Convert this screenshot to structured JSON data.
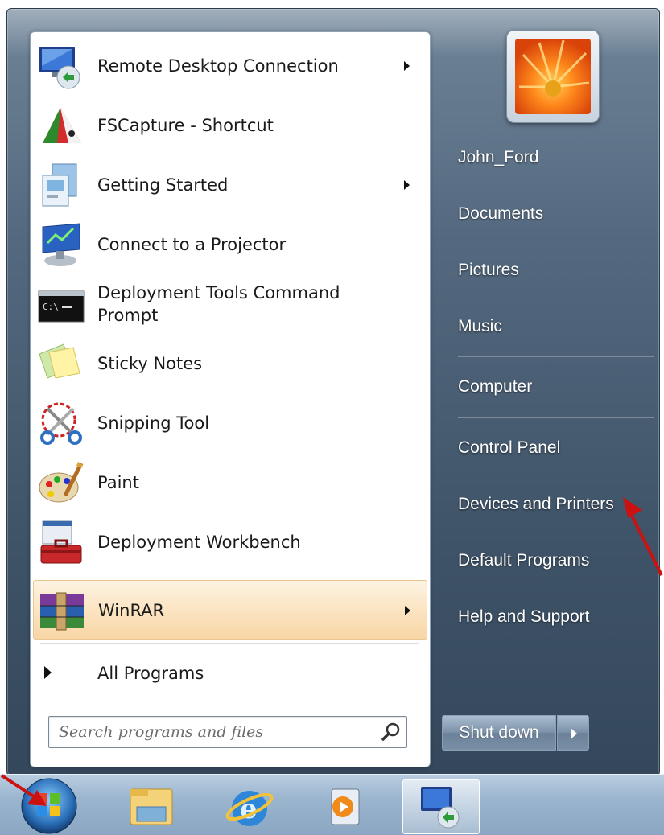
{
  "programs": [
    {
      "label": "Remote Desktop Connection",
      "icon": "remote-desktop-icon",
      "has_submenu": true,
      "highlighted": false
    },
    {
      "label": "FSCapture - Shortcut",
      "icon": "fscapture-icon",
      "has_submenu": false,
      "highlighted": false
    },
    {
      "label": "Getting Started",
      "icon": "getting-started-icon",
      "has_submenu": true,
      "highlighted": false
    },
    {
      "label": "Connect to a Projector",
      "icon": "projector-icon",
      "has_submenu": false,
      "highlighted": false
    },
    {
      "label": "Deployment Tools Command Prompt",
      "icon": "command-prompt-icon",
      "has_submenu": false,
      "highlighted": false
    },
    {
      "label": "Sticky Notes",
      "icon": "sticky-notes-icon",
      "has_submenu": false,
      "highlighted": false
    },
    {
      "label": "Snipping Tool",
      "icon": "scissors-icon",
      "has_submenu": false,
      "highlighted": false
    },
    {
      "label": "Paint",
      "icon": "paint-palette-icon",
      "has_submenu": false,
      "highlighted": false
    },
    {
      "label": "Deployment Workbench",
      "icon": "toolbox-icon",
      "has_submenu": false,
      "highlighted": false
    },
    {
      "label": "WinRAR",
      "icon": "winrar-icon",
      "has_submenu": true,
      "highlighted": true
    }
  ],
  "all_programs_label": "All Programs",
  "search": {
    "placeholder": "Search programs and files"
  },
  "right_links": {
    "user": "John_Ford",
    "documents": "Documents",
    "pictures": "Pictures",
    "music": "Music",
    "computer": "Computer",
    "control_panel": "Control Panel",
    "devices": "Devices and Printers",
    "default_programs": "Default Programs",
    "help": "Help and Support"
  },
  "shutdown_label": "Shut down",
  "colors": {
    "menu_bg": "#4b6075",
    "highlight": "#fbe3bf",
    "annotation_arrow": "#cc1111"
  },
  "taskbar": [
    "start-orb-icon",
    "windows-explorer-icon",
    "internet-explorer-icon",
    "media-player-icon",
    "remote-desktop-icon"
  ]
}
